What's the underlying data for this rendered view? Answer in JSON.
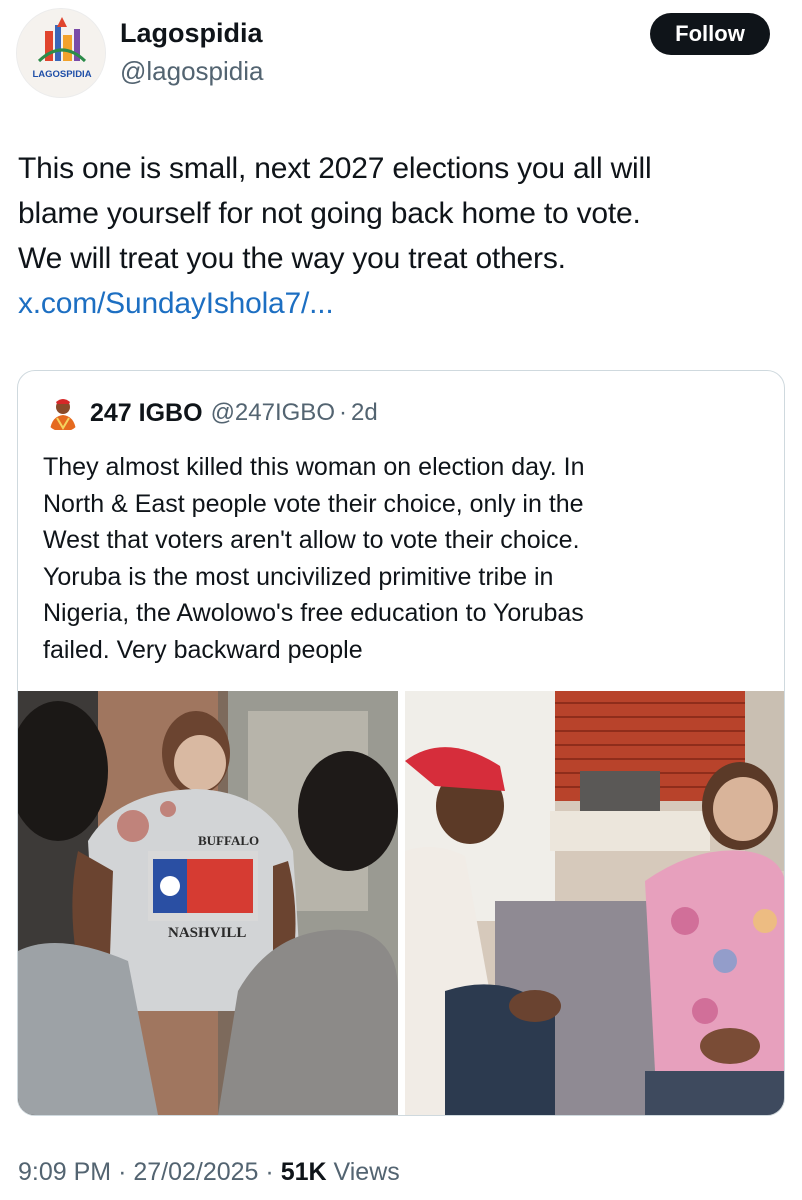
{
  "author": {
    "name": "Lagospidia",
    "handle": "@lagospidia",
    "avatar_text": "LAGOSPIDIA",
    "avatar_icon": "lagospidia-logo"
  },
  "follow_label": "Follow",
  "tweet": {
    "lines": [
      "This one is small, next 2027 elections you all will",
      "blame yourself for not going back home to vote.",
      "We will treat you the way you treat others."
    ],
    "link": "x.com/SundayIshola7/..."
  },
  "quoted": {
    "name": "247 IGBO",
    "handle": "@247IGBO",
    "separator": "·",
    "time": "2d",
    "lines": [
      "They almost killed this woman on election day. In",
      "North & East people vote their choice, only in the",
      "West that voters aren't allow to vote their choice.",
      "Yoruba is the most uncivilized primitive tribe in",
      "Nigeria, the Awolowo's free education to Yorubas",
      "failed. Very backward people"
    ],
    "photo_left_shirt_text": "BUFFALO",
    "photo_left_shirt_text2": "NASHVILL"
  },
  "meta": {
    "time": "9:09 PM",
    "dot": "·",
    "date": "27/02/2025",
    "views_count": "51K",
    "views_label": "Views"
  },
  "colors": {
    "link": "#1d6fc2",
    "muted": "#536471",
    "text": "#0f1419",
    "border": "#cfd9de"
  }
}
